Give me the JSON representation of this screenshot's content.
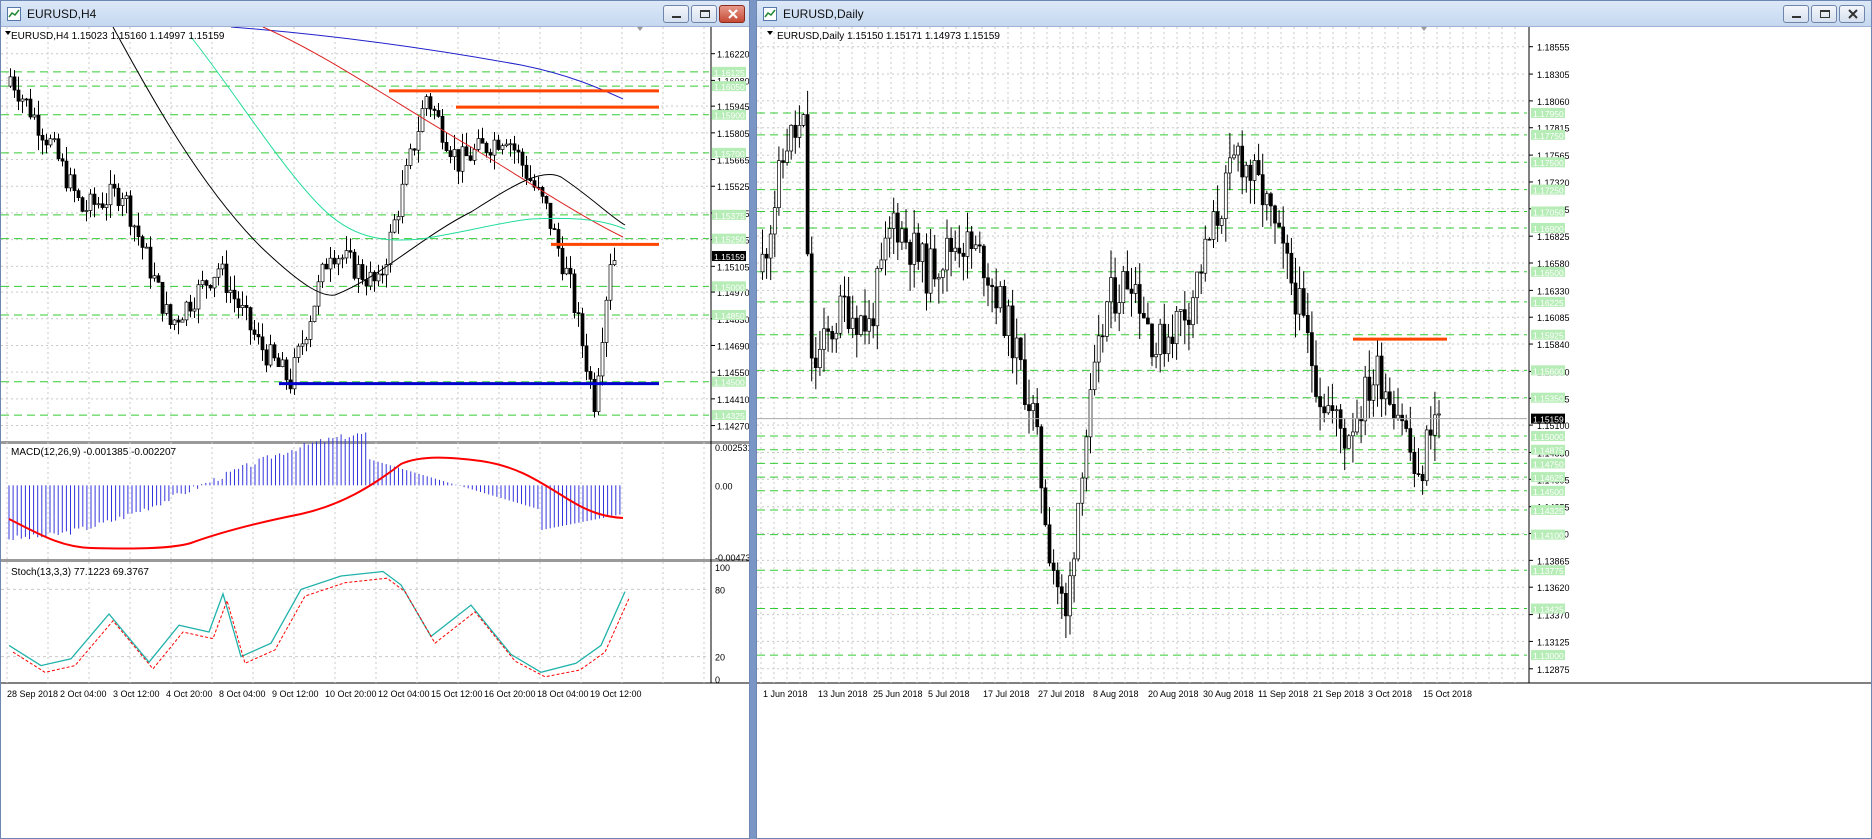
{
  "windows": {
    "h4": {
      "title": "EURUSD,H4",
      "header": "EURUSD,H4  1.15023 1.15160 1.14997 1.15159",
      "macd_label": "MACD(12,26,9) -0.001385 -0.002207",
      "stoch_label": "Stoch(13,3,3) 77.1223 69.3767",
      "price_ticks": [
        "1.16220",
        "1.16080",
        "1.15945",
        "1.15805",
        "1.15665",
        "1.15525",
        "1.15385",
        "1.15245",
        "1.15105",
        "1.14970",
        "1.14830",
        "1.14690",
        "1.14550",
        "1.14410",
        "1.14270"
      ],
      "level_tags": [
        "1.16125",
        "1.16050",
        "1.15900",
        "1.15700",
        "1.15375",
        "1.15250",
        "1.15000",
        "1.14850",
        "1.14500",
        "1.14325"
      ],
      "current_price_tag": "1.15159",
      "macd_ticks": [
        "0.002531",
        "0.00",
        "-0.004734"
      ],
      "stoch_ticks": [
        "100",
        "80",
        "20",
        "0"
      ],
      "time_ticks": [
        "28 Sep 2018",
        "2 Oct 04:00",
        "3 Oct 12:00",
        "4 Oct 20:00",
        "8 Oct 04:00",
        "9 Oct 12:00",
        "10 Oct 20:00",
        "12 Oct 04:00",
        "15 Oct 12:00",
        "16 Oct 20:00",
        "18 Oct 04:00",
        "19 Oct 12:00"
      ]
    },
    "daily": {
      "title": "EURUSD,Daily",
      "header": "EURUSD,Daily  1.15150 1.15171 1.14973 1.15159",
      "price_ticks": [
        "1.18555",
        "1.18305",
        "1.18060",
        "1.17815",
        "1.17565",
        "1.17320",
        "1.17075",
        "1.16825",
        "1.16580",
        "1.16330",
        "1.16085",
        "1.15840",
        "1.15590",
        "1.15345",
        "1.15100",
        "1.14850",
        "1.14605",
        "1.14355",
        "1.14110",
        "1.13865",
        "1.13620",
        "1.13370",
        "1.13125",
        "1.12875"
      ],
      "level_tags": [
        "1.17950",
        "1.17750",
        "1.17500",
        "1.17250",
        "1.17050",
        "1.16900",
        "1.16500",
        "1.16225",
        "1.15925",
        "1.15600",
        "1.15350",
        "1.15000",
        "1.14875",
        "1.14750",
        "1.14625",
        "1.14500",
        "1.14325",
        "1.14100",
        "1.13775",
        "1.13425",
        "1.13000"
      ],
      "current_price_tag": "1.15159",
      "time_ticks": [
        "1 Jun 2018",
        "13 Jun 2018",
        "25 Jun 2018",
        "5 Jul 2018",
        "17 Jul 2018",
        "27 Jul 2018",
        "8 Aug 2018",
        "20 Aug 2018",
        "30 Aug 2018",
        "11 Sep 2018",
        "21 Sep 2018",
        "3 Oct 2018",
        "15 Oct 2018"
      ]
    }
  },
  "colors": {
    "grid": "#c9c9c9",
    "level_line": "#33cc33",
    "resistance": "#ff4500",
    "support": "#0000cc",
    "ma_blue": "#2020cc",
    "ma_red": "#dd2222",
    "ma_black": "#000000",
    "ma_green": "#22dd99",
    "macd_hist": "#3333dd",
    "macd_signal": "#ff0000",
    "stoch_main": "#20b2aa",
    "stoch_signal": "#ff0000"
  },
  "icons": {
    "chart": "chart-window-icon",
    "minimize": "minimize-icon",
    "maximize": "maximize-icon",
    "close": "close-icon",
    "dropdown": "triangle-down-icon"
  }
}
